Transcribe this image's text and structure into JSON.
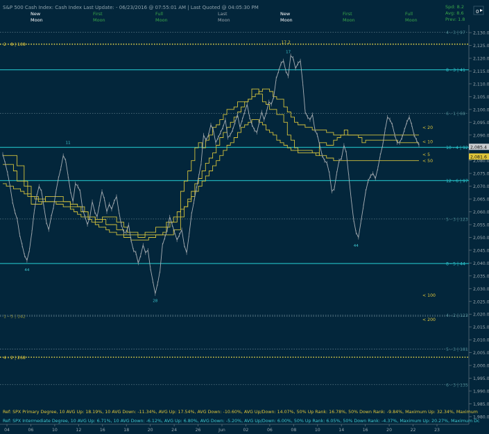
{
  "header": {
    "title": "S&P 500 Cash Index:  Cash Index  Last Update: - 06/23/2016 @ 07:55:01 AM | Last Quoted @ 04:05:30 PM",
    "moon_labels": [
      {
        "line1": "New",
        "line2": "Moon",
        "color": "#ffffff"
      },
      {
        "line1": "First",
        "line2": "Moon",
        "color": "#3aa84a"
      },
      {
        "line1": "Full",
        "line2": "Moon",
        "color": "#3aa84a"
      },
      {
        "line1": "Last",
        "line2": "Moon",
        "color": "#9aa5ad"
      },
      {
        "line1": "New",
        "line2": "Moon",
        "color": "#ffffff"
      },
      {
        "line1": "First",
        "line2": "Moon",
        "color": "#3aa84a"
      },
      {
        "line1": "Full",
        "line2": "Moon",
        "color": "#3aa84a"
      }
    ],
    "stats": {
      "spd": "Spd: 8.2",
      "avg": "Avg: 8.6",
      "prev": "Prev: 1.8"
    },
    "menu_icon_text": "0"
  },
  "colors": {
    "background": "#03263b",
    "price": "#a9b0b6",
    "yellow": "#d4c23c",
    "cyan": "#1fb0b8",
    "gray_text": "#6d8794"
  },
  "chart_data": {
    "type": "line",
    "title": "S&P 500 Cash Index",
    "x_tick_labels": [
      "04",
      "06",
      "10",
      "12",
      "16",
      "18",
      "20",
      "24",
      "26",
      "Jun",
      "02",
      "06",
      "08",
      "10",
      "14",
      "16",
      "20",
      "22",
      "23"
    ],
    "y_ticks": [
      1980,
      1985,
      1990,
      1995,
      2000,
      2005,
      2010,
      2015,
      2020,
      2025,
      2030,
      2035,
      2040,
      2045,
      2050,
      2055,
      2060,
      2065,
      2070,
      2075,
      2080,
      2085,
      2090,
      2095,
      2100,
      2105,
      2110,
      2115,
      2120,
      2125,
      2130
    ],
    "y_tick_labels": [
      "1,980.00",
      "1,985.00",
      "1,990.00",
      "1,995.00",
      "2,000.00",
      "2,005.00",
      "2,010.00",
      "2,015.00",
      "2,020.00",
      "2,025.00",
      "2,030.00",
      "2,035.00",
      "2,040.00",
      "2,045.00",
      "2,050.00",
      "2,055.00",
      "2,060.00",
      "2,065.00",
      "2,070.00",
      "2,075.00",
      "2,080.00",
      "2,085.00",
      "2,090.00",
      "2,095.00",
      "2,100.00",
      "2,105.00",
      "2,110.00",
      "2,115.00",
      "2,120.00",
      "2,125.00",
      "2,130.00"
    ],
    "ylim": [
      1977,
      2133
    ],
    "grid": false,
    "price_series": {
      "name": "SPX",
      "values": [
        2082.5,
        2079,
        2075,
        2070,
        2064,
        2060,
        2057,
        2051,
        2047,
        2043,
        2041,
        2045,
        2052,
        2060,
        2066,
        2070,
        2068,
        2062,
        2056,
        2053,
        2058,
        2062,
        2068,
        2073,
        2077,
        2082,
        2080,
        2074,
        2068,
        2064,
        2071,
        2070,
        2068,
        2061,
        2058,
        2055,
        2058,
        2064,
        2060,
        2058,
        2063,
        2068,
        2065,
        2060,
        2063,
        2061,
        2064,
        2066,
        2060,
        2055,
        2052,
        2052,
        2055,
        2049,
        2045,
        2044,
        2040,
        2043,
        2047,
        2044,
        2045,
        2038,
        2033,
        2028,
        2032,
        2037,
        2047,
        2050,
        2053,
        2058,
        2055,
        2052,
        2049,
        2051,
        2053,
        2047,
        2044,
        2051,
        2059,
        2064,
        2069,
        2074,
        2079,
        2090,
        2088,
        2090,
        2094,
        2092,
        2087,
        2089,
        2091,
        2093,
        2096,
        2089,
        2090,
        2092,
        2095,
        2098,
        2093,
        2096,
        2099,
        2102,
        2097,
        2094,
        2092,
        2091,
        2095,
        2099,
        2096,
        2099,
        2103,
        2102,
        2105,
        2112,
        2115,
        2118,
        2119,
        2115,
        2113,
        2121,
        2120,
        2116,
        2118,
        2119,
        2110,
        2099,
        2097,
        2096,
        2098,
        2092,
        2090,
        2086,
        2082,
        2080,
        2079,
        2075,
        2068,
        2069,
        2075,
        2080,
        2081,
        2086,
        2083,
        2074,
        2065,
        2057,
        2052,
        2050,
        2056,
        2062,
        2068,
        2072,
        2074,
        2075,
        2073,
        2077,
        2082,
        2086,
        2092,
        2097,
        2096,
        2094,
        2090,
        2087,
        2087,
        2089,
        2092,
        2095,
        2097,
        2094,
        2090,
        2088,
        2086
      ]
    },
    "yellow_step_lines": [
      {
        "name": "10",
        "values": [
          2078.5,
          2078.5,
          2078.5,
          2076,
          2072,
          2072,
          2070,
          2067,
          2063,
          2063,
          2063,
          2064,
          2064,
          2064,
          2064,
          2064,
          2064,
          2064,
          2064,
          2062,
          2062,
          2062,
          2060,
          2060,
          2058,
          2058,
          2056,
          2056,
          2058,
          2058,
          2058,
          2058,
          2056,
          2056,
          2054,
          2052,
          2052,
          2052,
          2050,
          2050,
          2052,
          2052,
          2052,
          2054,
          2054,
          2054,
          2056,
          2056,
          2056,
          2058,
          2068,
          2072,
          2076,
          2080,
          2085,
          2087,
          2085,
          2088,
          2090,
          2093,
          2094,
          2096,
          2098,
          2100,
          2100,
          2101,
          2103,
          2103,
          2103,
          2104,
          2108,
          2108,
          2106,
          2103,
          2102,
          2100,
          2100,
          2098,
          2098,
          2095,
          2090,
          2088,
          2085,
          2083,
          2083,
          2083,
          2083,
          2083,
          2082,
          2087,
          2087,
          2086,
          2086,
          2088,
          2089,
          2090,
          2092,
          2090,
          2090,
          2090,
          2089,
          2087,
          2088,
          2088,
          2088,
          2088,
          2088,
          2088,
          2088,
          2088,
          2088,
          2087,
          2087,
          2087,
          2087,
          2087,
          2087,
          2087
        ]
      },
      {
        "name": "20",
        "values": [
          2082,
          2082,
          2082,
          2082,
          2078,
          2078,
          2072,
          2070,
          2066,
          2066,
          2064,
          2064,
          2066,
          2066,
          2066,
          2066,
          2066,
          2064,
          2064,
          2063,
          2063,
          2062,
          2062,
          2060,
          2058,
          2058,
          2057,
          2057,
          2057,
          2055,
          2055,
          2055,
          2053,
          2053,
          2051,
          2051,
          2051,
          2051,
          2051,
          2051,
          2051,
          2051,
          2051,
          2051,
          2051,
          2051,
          2051,
          2051,
          2053,
          2053,
          2058,
          2062,
          2065,
          2068,
          2071,
          2073,
          2076,
          2079,
          2081,
          2083,
          2086,
          2089,
          2091,
          2093,
          2095,
          2097,
          2099,
          2101,
          2103,
          2104,
          2105,
          2106,
          2107,
          2108,
          2108,
          2107,
          2105,
          2104,
          2104,
          2101,
          2099,
          2097,
          2095,
          2094,
          2094,
          2093,
          2093,
          2092,
          2092,
          2092,
          2092,
          2091,
          2091,
          2090,
          2090,
          2090,
          2090,
          2090,
          2090,
          2090,
          2090,
          2090,
          2090,
          2090,
          2090,
          2090,
          2090,
          2090,
          2090,
          2090,
          2090,
          2090,
          2090,
          2090,
          2090,
          2090,
          2090,
          2090
        ]
      },
      {
        "name": "50",
        "values": [
          2071,
          2070,
          2070,
          2069,
          2069,
          2068,
          2067,
          2066,
          2066,
          2065,
          2065,
          2065,
          2064,
          2064,
          2064,
          2063,
          2063,
          2062,
          2062,
          2061,
          2060,
          2059,
          2058,
          2058,
          2057,
          2056,
          2055,
          2054,
          2054,
          2053,
          2052,
          2052,
          2051,
          2051,
          2050,
          2050,
          2049,
          2049,
          2049,
          2049,
          2049,
          2050,
          2050,
          2051,
          2051,
          2052,
          2054,
          2056,
          2058,
          2060,
          2061,
          2062,
          2064,
          2066,
          2068,
          2070,
          2072,
          2074,
          2076,
          2078,
          2080,
          2082,
          2084,
          2086,
          2087,
          2089,
          2091,
          2093,
          2094,
          2095,
          2096,
          2096,
          2095,
          2094,
          2092,
          2091,
          2090,
          2088,
          2087,
          2086,
          2085,
          2084,
          2084,
          2084,
          2084,
          2084,
          2084,
          2083,
          2083,
          2082,
          2082,
          2081,
          2081,
          2080,
          2080,
          2080,
          2080,
          2080,
          2080,
          2080,
          2080,
          2080,
          2080,
          2080,
          2080,
          2080,
          2080,
          2080,
          2080,
          2080,
          2080,
          2080,
          2080,
          2080,
          2080,
          2080,
          2080,
          2080
        ]
      }
    ],
    "horizontal_levels": [
      {
        "value": 2125.5,
        "label": "2 - 8 | 108",
        "label_side": "left",
        "style": "yellow-dotted"
      },
      {
        "value": 2130.2,
        "label": "4 - 3 | 97",
        "label_side": "right",
        "style": "gray-dashed"
      },
      {
        "value": 2115.5,
        "label": "8 - 3 | 41",
        "label_side": "right",
        "style": "cyan-solid"
      },
      {
        "value": 2098.5,
        "label": "6 - 1 | 69",
        "label_side": "right",
        "style": "gray-dashed"
      },
      {
        "value": 2085.2,
        "label": "10 - 4 | 92",
        "label_side": "right",
        "style": "cyan-solid"
      },
      {
        "value": 2072.2,
        "label": "12 - 6 | 97",
        "label_side": "right",
        "style": "cyan-solid"
      },
      {
        "value": 2057.2,
        "label": "5 - 3 | 123",
        "label_side": "right",
        "style": "gray-dashed"
      },
      {
        "value": 2039.8,
        "label": "8 - 5 | 44",
        "label_side": "right",
        "style": "cyan-solid"
      },
      {
        "value": 2019.2,
        "label": "1 - 5 | 142",
        "label_side": "left",
        "style": "gray-dashed"
      },
      {
        "value": 2019.6,
        "label": "4 - 2 | 123",
        "label_side": "right",
        "style": "gray-dashed"
      },
      {
        "value": 2006.4,
        "label": "5 - 3 | 181",
        "label_side": "right",
        "style": "gray-dashed"
      },
      {
        "value": 2003.2,
        "label": "4 - 2 | 268",
        "label_side": "left",
        "style": "yellow-dotted"
      },
      {
        "value": 1992.5,
        "label": "6 - 3 | 135",
        "label_side": "right",
        "style": "gray-dashed"
      }
    ],
    "ma_labels": [
      {
        "value": 2093,
        "label": "< 20"
      },
      {
        "value": 2087.5,
        "label": "< 10"
      },
      {
        "value": 2082.5,
        "label": "< 5"
      },
      {
        "value": 2080,
        "label": "< 50"
      },
      {
        "value": 2027.5,
        "label": "< 100"
      },
      {
        "value": 2018,
        "label": "< 200"
      }
    ],
    "price_tags": [
      {
        "value": 2085.4,
        "label": "2,085.4",
        "color": "#c9ccd0"
      },
      {
        "value": 2081.6,
        "label": "2,081.6",
        "color": "#e0c63a"
      }
    ],
    "pivot_markers": [
      {
        "index": 10,
        "value": 2039,
        "label": "44"
      },
      {
        "index": 27,
        "value": 2086,
        "label": "11"
      },
      {
        "index": 63,
        "value": 2027,
        "label": "28"
      },
      {
        "index": 118,
        "value": 2121.5,
        "label": "17"
      },
      {
        "index": 146,
        "value": 2048.5,
        "label": "44"
      }
    ],
    "top_marker": {
      "index": 117,
      "value": 2126,
      "label": "17.2"
    },
    "footer_lines": [
      {
        "text": "Ref: SPX Primary Degree, 10 AVG Up: 18.19%, 10 AVG Down: -11.34%, AVG Up: 17.54%, AVG Down: -10.60%, AVG Up/Down: 14.07%, 50%  Up Rank: 16.78%, 50% Down Rank: -9.84%, Maximum Up: 32.34%, Maximum",
        "color": "#e0c63a"
      },
      {
        "text": "Ref: SPX Intermediate Degree, 10 AVG Up: 6.71%, 10 AVG Down: -6.12%, AVG Up: 6.80%, AVG Down: -5.20%, AVG Up/Down: 6.00%, 50%  Up Rank: 6.05%, 50% Down Rank: -4.37%, Maximum Up: 20.27%, Maximum Dc",
        "color": "#3fc8d0"
      }
    ]
  }
}
